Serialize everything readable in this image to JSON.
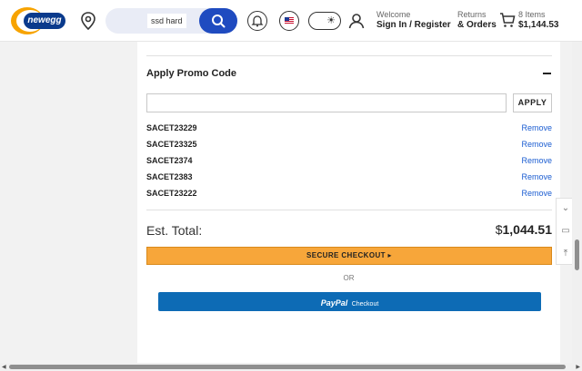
{
  "header": {
    "logo_text": "newegg",
    "search": {
      "query": "ssd hard"
    },
    "welcome": {
      "label": "Welcome",
      "action": "Sign In / Register"
    },
    "returns": {
      "label": "Returns",
      "action": "& Orders"
    },
    "cart": {
      "items": "8 Items",
      "total": "$1,144.53"
    },
    "icons": [
      "location-pin-icon",
      "search-icon",
      "bell-icon",
      "us-flag-icon",
      "theme-toggle-icon",
      "user-icon",
      "cart-icon"
    ]
  },
  "promo": {
    "title": "Apply Promo Code",
    "input_value": "",
    "apply_label": "APPLY",
    "codes": [
      {
        "code": "SACET23229",
        "action": "Remove"
      },
      {
        "code": "SACET23325",
        "action": "Remove"
      },
      {
        "code": "SACET2374",
        "action": "Remove"
      },
      {
        "code": "SACET2383",
        "action": "Remove"
      },
      {
        "code": "SACET23222",
        "action": "Remove"
      }
    ]
  },
  "summary": {
    "total_label": "Est. Total:",
    "total_currency": "$",
    "total_value": "1,044.51",
    "checkout_label": "SECURE CHECKOUT",
    "or_label": "OR",
    "paypal_label": "PayPal",
    "paypal_checkout": "Checkout"
  },
  "colors": {
    "accent_orange": "#f7a63a",
    "paypal_blue": "#0d6bb5",
    "link_blue": "#1a5cd1",
    "search_blue": "#1f4bc0"
  }
}
